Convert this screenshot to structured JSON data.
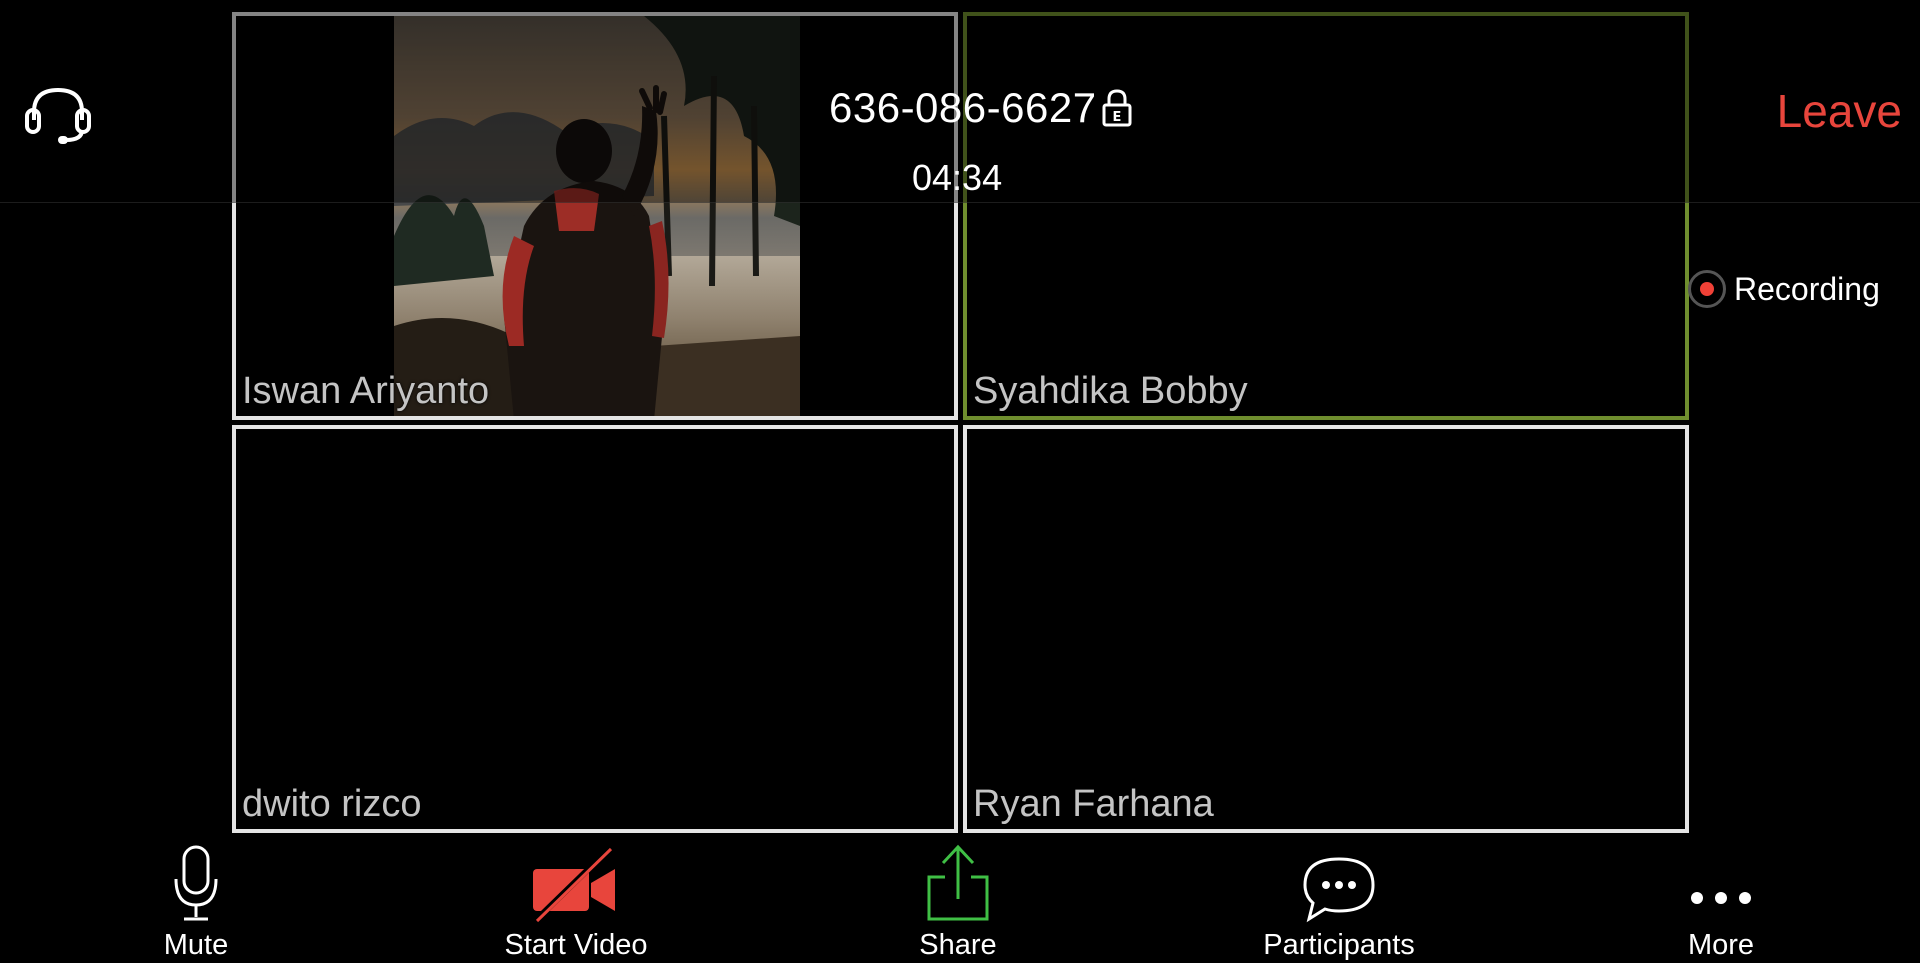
{
  "meeting": {
    "id": "636-086-6627",
    "timer": "04:34",
    "leave_label": "Leave",
    "recording_label": "Recording"
  },
  "participants": [
    {
      "name": "Iswan Ariyanto",
      "video_on": true,
      "active_speaker": false
    },
    {
      "name": "Syahdika Bobby",
      "video_on": false,
      "active_speaker": true
    },
    {
      "name": "dwito rizco",
      "video_on": false,
      "active_speaker": false
    },
    {
      "name": "Ryan Farhana",
      "video_on": false,
      "active_speaker": false
    }
  ],
  "toolbar": {
    "mute_label": "Mute",
    "start_video_label": "Start Video",
    "share_label": "Share",
    "participants_label": "Participants",
    "more_label": "More"
  },
  "icons": {
    "audio": "headset-icon",
    "lock": "lock-encrypted-icon",
    "mute": "microphone-icon",
    "video": "video-camera-off-icon",
    "share": "share-upload-icon",
    "participants": "chat-bubble-icon",
    "more": "more-dots-icon"
  },
  "colors": {
    "leave": "#e8453c",
    "active_speaker_border": "#6f8e2e",
    "tile_border": "#e4e4e4",
    "video_off": "#e8453c",
    "share": "#3fbf45",
    "recording_dot": "#f04137"
  }
}
